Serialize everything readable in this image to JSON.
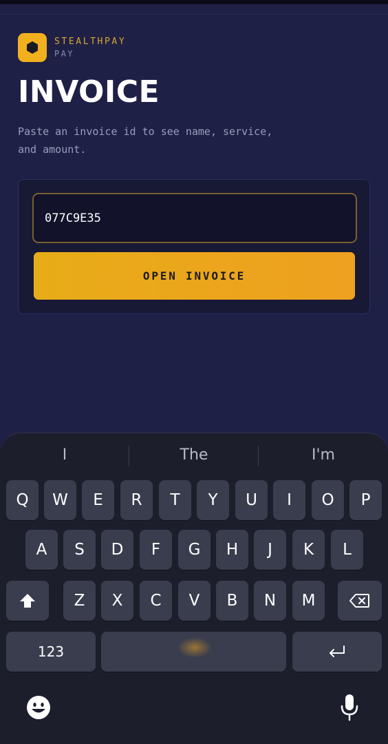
{
  "brand": {
    "name": "STEALTHPAY",
    "sub": "PAY",
    "accent": "#f2b01e"
  },
  "page": {
    "title": "INVOICE",
    "subtitle": "Paste an invoice id to see name, service, and amount."
  },
  "form": {
    "invoice_value": "077C9E35",
    "open_button_label": "OPEN INVOICE"
  },
  "keyboard": {
    "suggestions": [
      "I",
      "The",
      "I'm"
    ],
    "row1": [
      "Q",
      "W",
      "E",
      "R",
      "T",
      "Y",
      "U",
      "I",
      "O",
      "P"
    ],
    "row2": [
      "A",
      "S",
      "D",
      "F",
      "G",
      "H",
      "J",
      "K",
      "L"
    ],
    "row3": [
      "Z",
      "X",
      "C",
      "V",
      "B",
      "N",
      "M"
    ],
    "numbers_label": "123",
    "icons": {
      "shift": "shift-icon",
      "backspace": "backspace-icon",
      "return": "return-icon",
      "emoji": "emoji-icon",
      "mic": "microphone-icon"
    }
  }
}
